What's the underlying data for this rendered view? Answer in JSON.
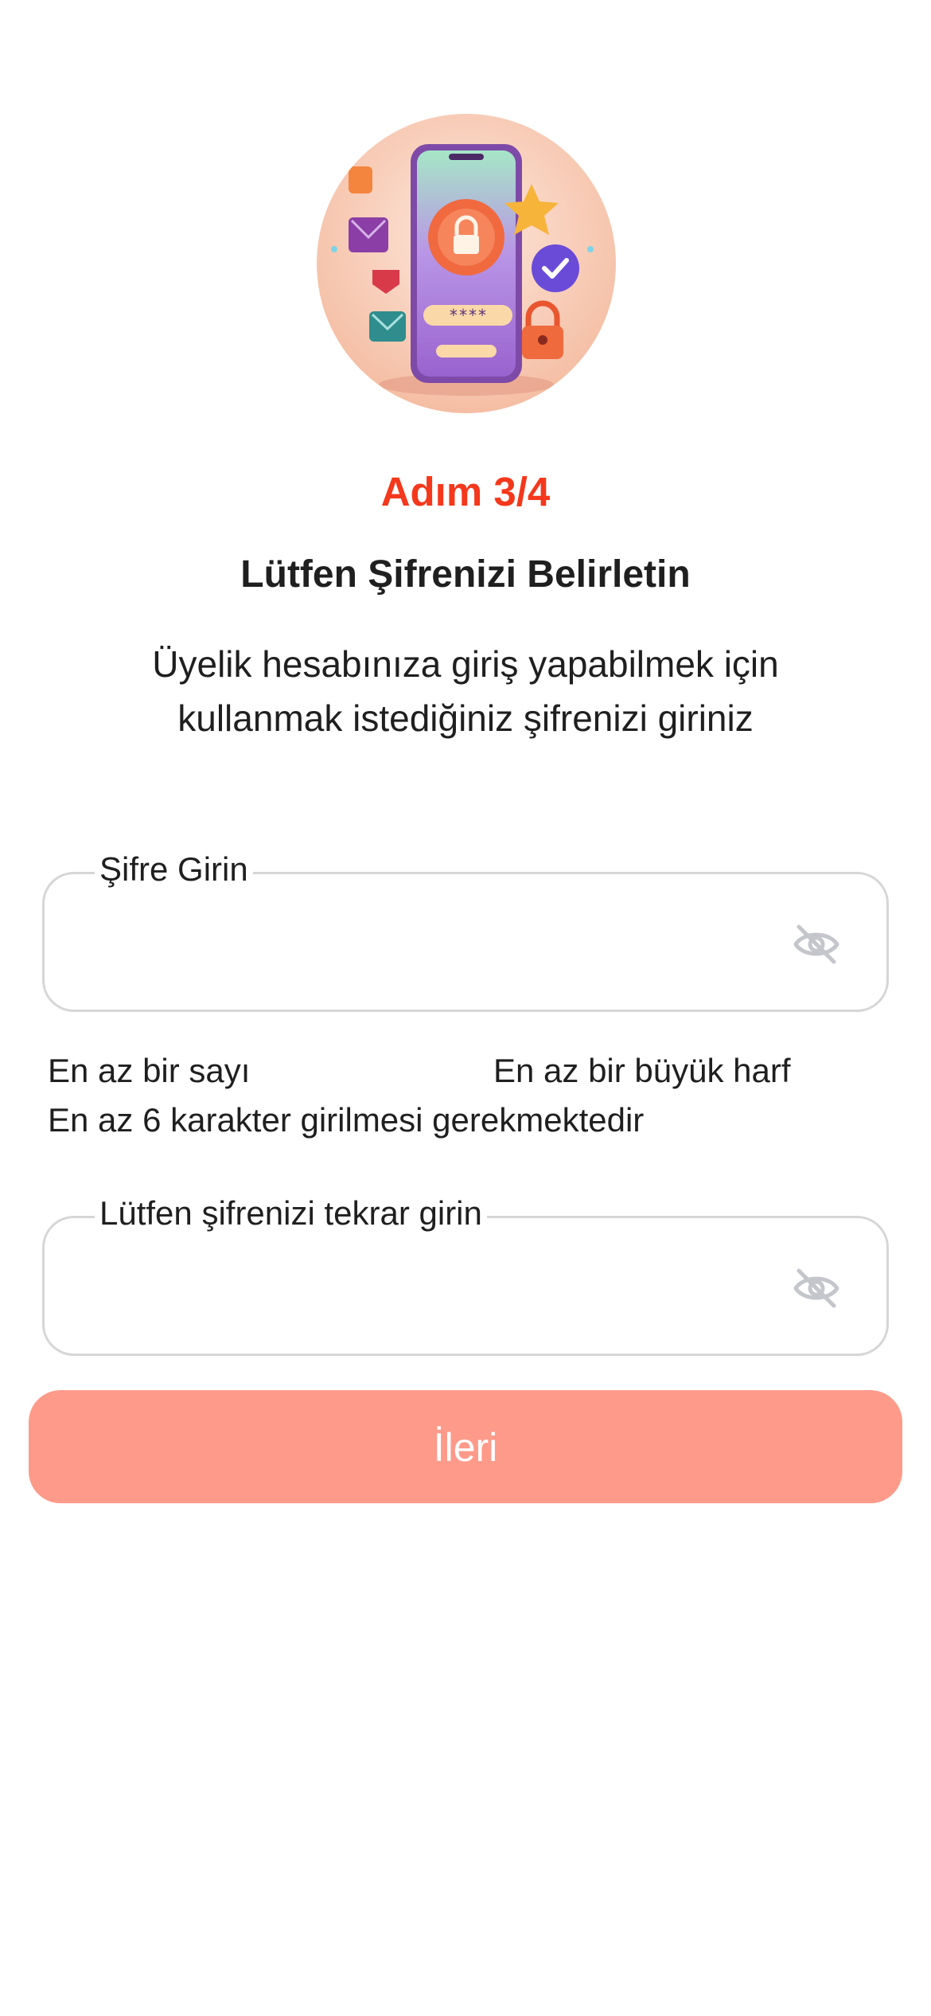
{
  "hero": {
    "illustration": "phone-password-lock-illustration",
    "masked_text": "****"
  },
  "header": {
    "step": "Adım 3/4",
    "title": "Lütfen Şifrenizi Belirletin",
    "description": "Üyelik hesabınıza giriş yapabilmek için kullanmak istediğiniz şifrenizi giriniz"
  },
  "password_field": {
    "label": "Şifre Girin",
    "value": "",
    "icon": "eye-off-icon"
  },
  "rules": {
    "number": "En az bir sayı",
    "uppercase": "En az bir büyük harf",
    "length": "En az 6 karakter girilmesi gerekmektedir"
  },
  "confirm_field": {
    "label": "Lütfen şifrenizi tekrar girin",
    "value": "",
    "icon": "eye-off-icon"
  },
  "next_button": {
    "label": "İleri"
  },
  "colors": {
    "accent": "#f4381c",
    "button": "#fe9a8a",
    "field_border": "#d6d6d6",
    "icon": "#c4c6cc"
  }
}
